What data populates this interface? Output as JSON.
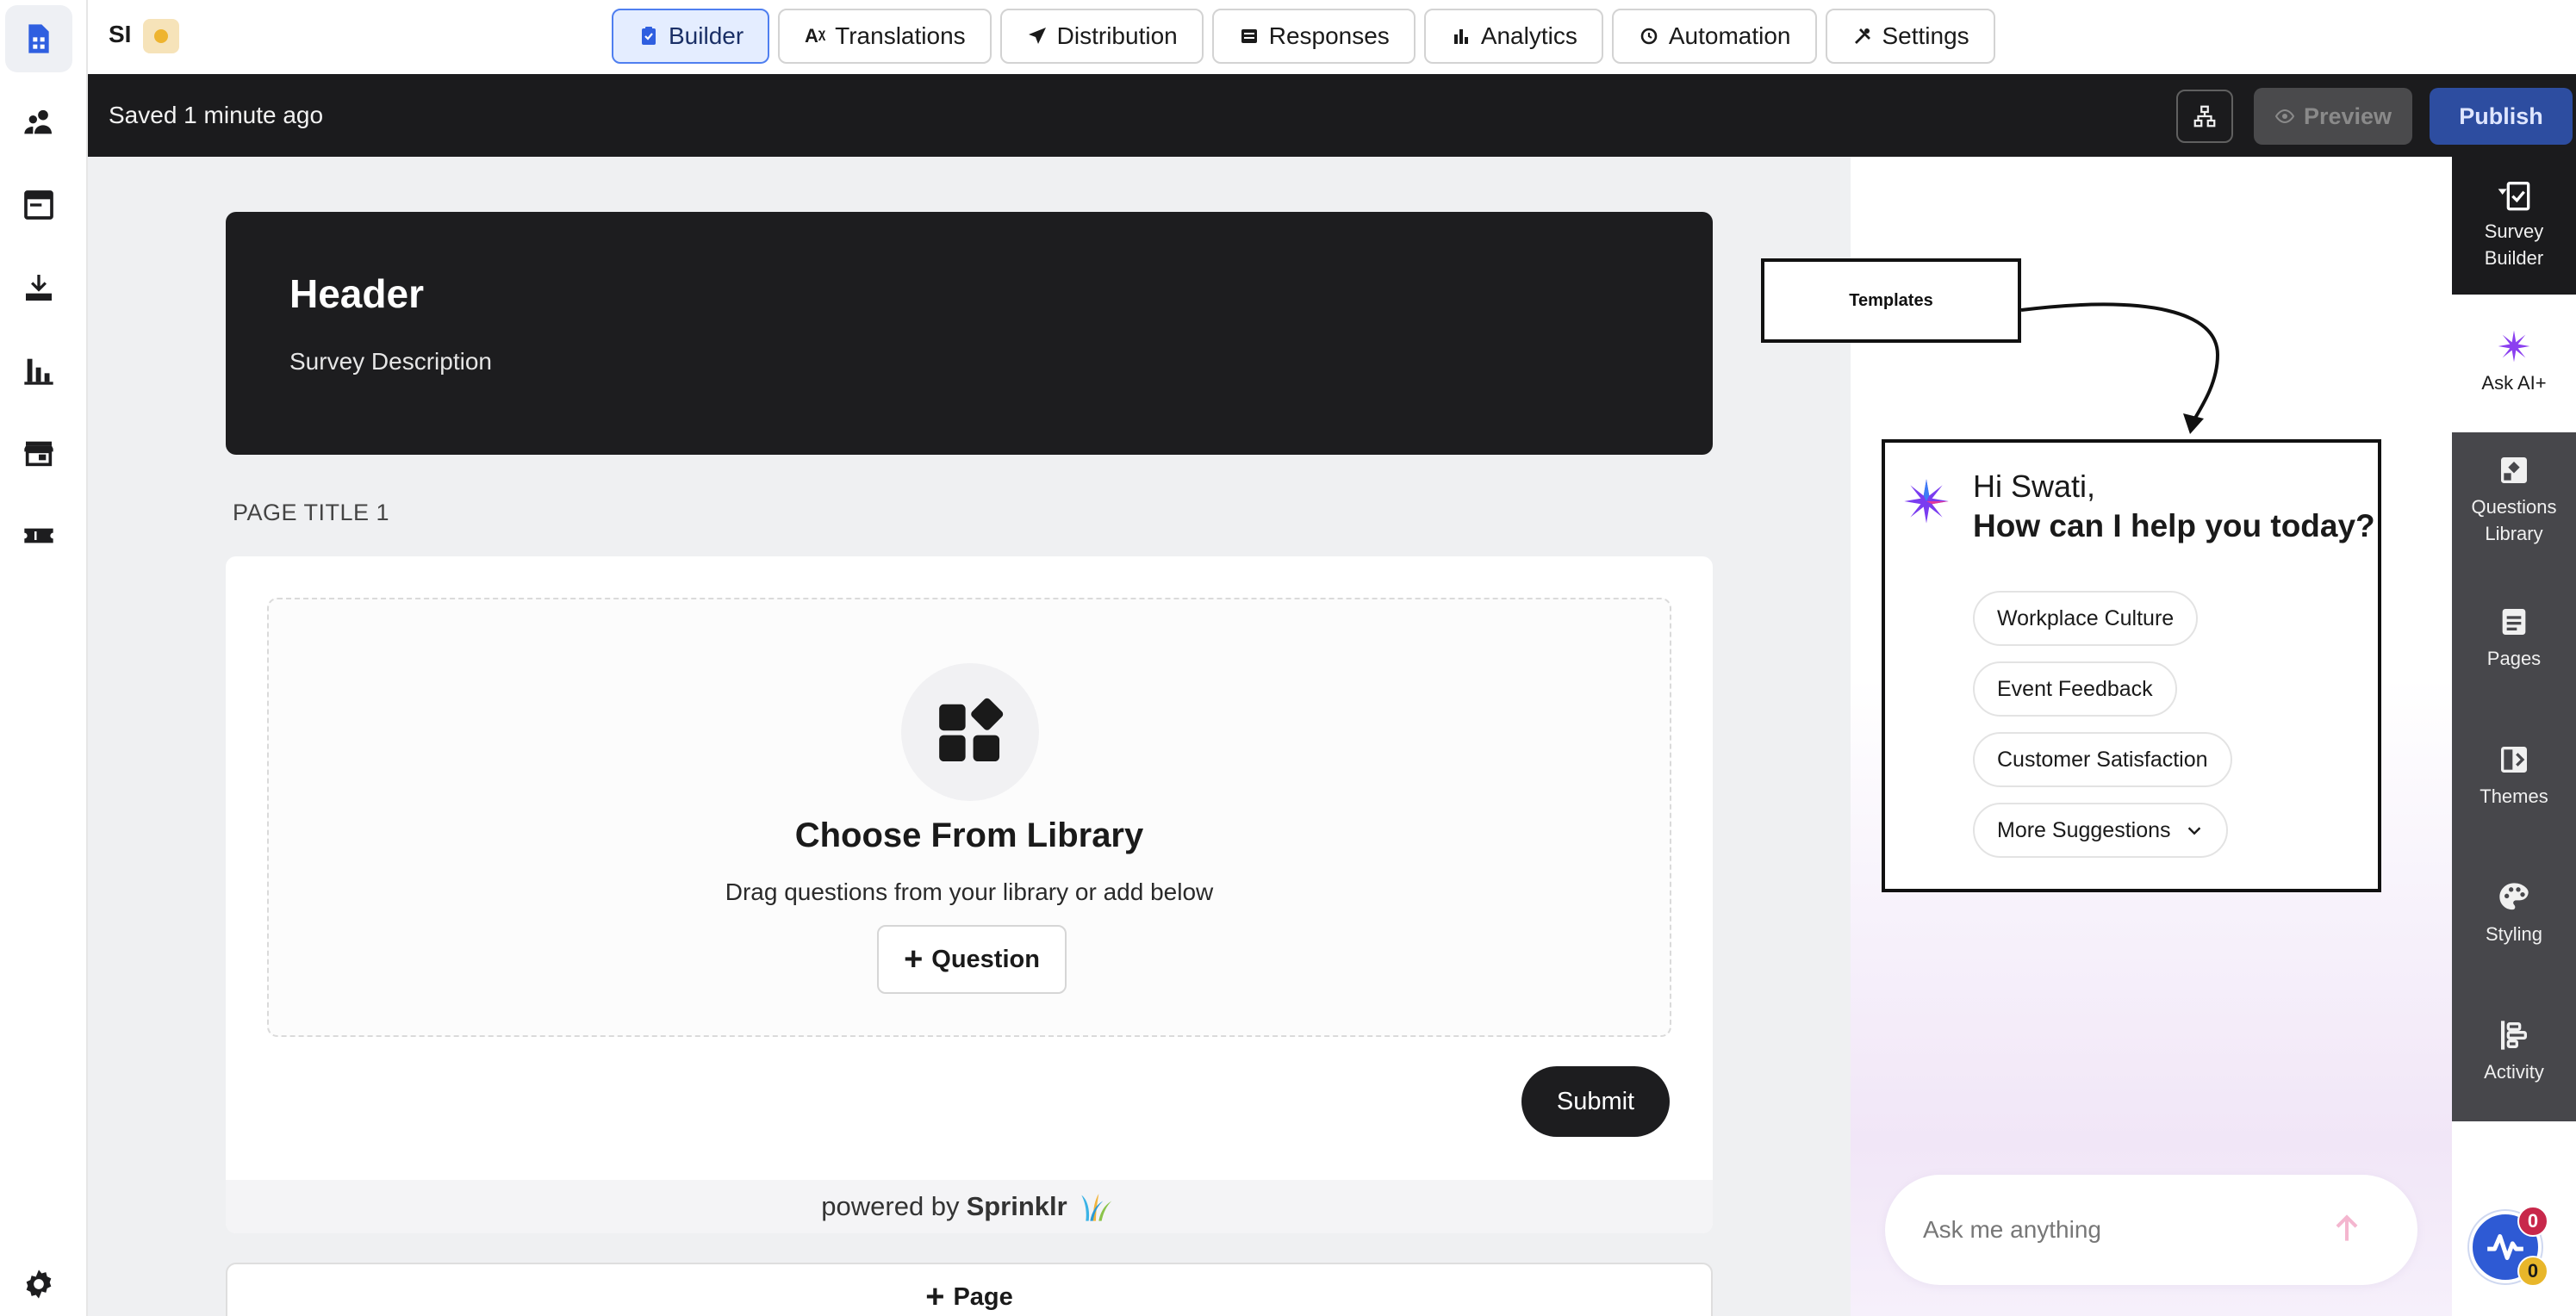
{
  "app": {
    "initials": "SI"
  },
  "tabs": [
    {
      "label": "Builder",
      "icon": "clipboard-check-icon",
      "active": true
    },
    {
      "label": "Translations",
      "icon": "translate-icon",
      "active": false
    },
    {
      "label": "Distribution",
      "icon": "send-icon",
      "active": false
    },
    {
      "label": "Responses",
      "icon": "list-icon",
      "active": false
    },
    {
      "label": "Analytics",
      "icon": "bar-chart-icon",
      "active": false
    },
    {
      "label": "Automation",
      "icon": "automation-icon",
      "active": false
    },
    {
      "label": "Settings",
      "icon": "tools-icon",
      "active": false
    }
  ],
  "status": {
    "saved_text": "Saved 1 minute ago",
    "preview_label": "Preview",
    "publish_label": "Publish"
  },
  "survey": {
    "header_title": "Header",
    "header_description": "Survey Description",
    "page_title": "PAGE TITLE 1",
    "library_title": "Choose From Library",
    "library_subtitle": "Drag questions from your library or add below",
    "question_button": "Question",
    "submit_label": "Submit",
    "powered_by": "powered by",
    "brand": "Sprinklr",
    "page_button": "Page"
  },
  "ai": {
    "templates_label": "Templates",
    "greeting": "Hi Swati,",
    "question": "How can I help you today?",
    "suggestions": [
      "Workplace Culture",
      "Event Feedback",
      "Customer Satisfaction"
    ],
    "more_label": "More Suggestions",
    "input_placeholder": "Ask me anything"
  },
  "rightbar": [
    {
      "label": "Survey Builder",
      "icon": "survey-builder-icon"
    },
    {
      "label": "Ask AI+",
      "icon": "ai-sparkle-icon"
    },
    {
      "label": "Questions Library",
      "icon": "questions-library-icon"
    },
    {
      "label": "Pages",
      "icon": "pages-icon"
    },
    {
      "label": "Themes",
      "icon": "themes-icon"
    },
    {
      "label": "Styling",
      "icon": "palette-icon"
    },
    {
      "label": "Activity",
      "icon": "activity-icon"
    }
  ],
  "badges": {
    "red_count": "0",
    "yellow_count": "0"
  },
  "colors": {
    "accent": "#4f7ff0",
    "publish": "#2d4da0",
    "dark": "#1d1d1f"
  }
}
